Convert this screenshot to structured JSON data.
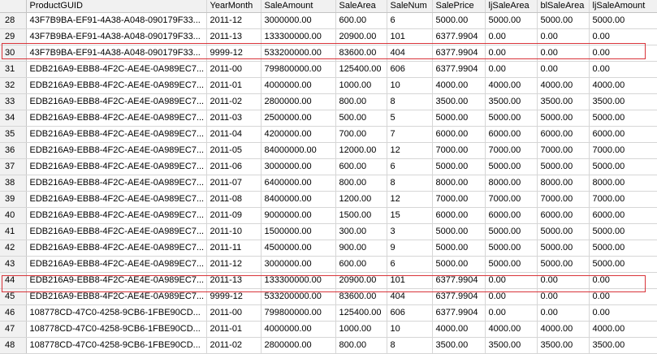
{
  "columns": [
    "",
    "ProductGUID",
    "YearMonth",
    "SaleAmount",
    "SaleArea",
    "SaleNum",
    "SalePrice",
    "ljSaleArea",
    "blSaleArea",
    "ljSaleAmount"
  ],
  "rows": [
    [
      "28",
      "43F7B9BA-EF91-4A38-A048-090179F33...",
      "2011-12",
      "3000000.00",
      "600.00",
      "6",
      "5000.00",
      "5000.00",
      "5000.00",
      "5000.00"
    ],
    [
      "29",
      "43F7B9BA-EF91-4A38-A048-090179F33...",
      "2011-13",
      "133300000.00",
      "20900.00",
      "101",
      "6377.9904",
      "0.00",
      "0.00",
      "0.00"
    ],
    [
      "30",
      "43F7B9BA-EF91-4A38-A048-090179F33...",
      "9999-12",
      "533200000.00",
      "83600.00",
      "404",
      "6377.9904",
      "0.00",
      "0.00",
      "0.00"
    ],
    [
      "31",
      "EDB216A9-EBB8-4F2C-AE4E-0A989EC7...",
      "2011-00",
      "799800000.00",
      "125400.00",
      "606",
      "6377.9904",
      "0.00",
      "0.00",
      "0.00"
    ],
    [
      "32",
      "EDB216A9-EBB8-4F2C-AE4E-0A989EC7...",
      "2011-01",
      "4000000.00",
      "1000.00",
      "10",
      "4000.00",
      "4000.00",
      "4000.00",
      "4000.00"
    ],
    [
      "33",
      "EDB216A9-EBB8-4F2C-AE4E-0A989EC7...",
      "2011-02",
      "2800000.00",
      "800.00",
      "8",
      "3500.00",
      "3500.00",
      "3500.00",
      "3500.00"
    ],
    [
      "34",
      "EDB216A9-EBB8-4F2C-AE4E-0A989EC7...",
      "2011-03",
      "2500000.00",
      "500.00",
      "5",
      "5000.00",
      "5000.00",
      "5000.00",
      "5000.00"
    ],
    [
      "35",
      "EDB216A9-EBB8-4F2C-AE4E-0A989EC7...",
      "2011-04",
      "4200000.00",
      "700.00",
      "7",
      "6000.00",
      "6000.00",
      "6000.00",
      "6000.00"
    ],
    [
      "36",
      "EDB216A9-EBB8-4F2C-AE4E-0A989EC7...",
      "2011-05",
      "84000000.00",
      "12000.00",
      "12",
      "7000.00",
      "7000.00",
      "7000.00",
      "7000.00"
    ],
    [
      "37",
      "EDB216A9-EBB8-4F2C-AE4E-0A989EC7...",
      "2011-06",
      "3000000.00",
      "600.00",
      "6",
      "5000.00",
      "5000.00",
      "5000.00",
      "5000.00"
    ],
    [
      "38",
      "EDB216A9-EBB8-4F2C-AE4E-0A989EC7...",
      "2011-07",
      "6400000.00",
      "800.00",
      "8",
      "8000.00",
      "8000.00",
      "8000.00",
      "8000.00"
    ],
    [
      "39",
      "EDB216A9-EBB8-4F2C-AE4E-0A989EC7...",
      "2011-08",
      "8400000.00",
      "1200.00",
      "12",
      "7000.00",
      "7000.00",
      "7000.00",
      "7000.00"
    ],
    [
      "40",
      "EDB216A9-EBB8-4F2C-AE4E-0A989EC7...",
      "2011-09",
      "9000000.00",
      "1500.00",
      "15",
      "6000.00",
      "6000.00",
      "6000.00",
      "6000.00"
    ],
    [
      "41",
      "EDB216A9-EBB8-4F2C-AE4E-0A989EC7...",
      "2011-10",
      "1500000.00",
      "300.00",
      "3",
      "5000.00",
      "5000.00",
      "5000.00",
      "5000.00"
    ],
    [
      "42",
      "EDB216A9-EBB8-4F2C-AE4E-0A989EC7...",
      "2011-11",
      "4500000.00",
      "900.00",
      "9",
      "5000.00",
      "5000.00",
      "5000.00",
      "5000.00"
    ],
    [
      "43",
      "EDB216A9-EBB8-4F2C-AE4E-0A989EC7...",
      "2011-12",
      "3000000.00",
      "600.00",
      "6",
      "5000.00",
      "5000.00",
      "5000.00",
      "5000.00"
    ],
    [
      "44",
      "EDB216A9-EBB8-4F2C-AE4E-0A989EC7...",
      "2011-13",
      "133300000.00",
      "20900.00",
      "101",
      "6377.9904",
      "0.00",
      "0.00",
      "0.00"
    ],
    [
      "45",
      "EDB216A9-EBB8-4F2C-AE4E-0A989EC7...",
      "9999-12",
      "533200000.00",
      "83600.00",
      "404",
      "6377.9904",
      "0.00",
      "0.00",
      "0.00"
    ],
    [
      "46",
      "108778CD-47C0-4258-9CB6-1FBE90CD...",
      "2011-00",
      "799800000.00",
      "125400.00",
      "606",
      "6377.9904",
      "0.00",
      "0.00",
      "0.00"
    ],
    [
      "47",
      "108778CD-47C0-4258-9CB6-1FBE90CD...",
      "2011-01",
      "4000000.00",
      "1000.00",
      "10",
      "4000.00",
      "4000.00",
      "4000.00",
      "4000.00"
    ],
    [
      "48",
      "108778CD-47C0-4258-9CB6-1FBE90CD...",
      "2011-02",
      "2800000.00",
      "800.00",
      "8",
      "3500.00",
      "3500.00",
      "3500.00",
      "3500.00"
    ]
  ],
  "highlighted_rows": [
    "30",
    "45"
  ],
  "colors": {
    "highlight": "#d9343a",
    "header_bg": "#f1f1f1",
    "gridline": "#d6d6d6"
  }
}
